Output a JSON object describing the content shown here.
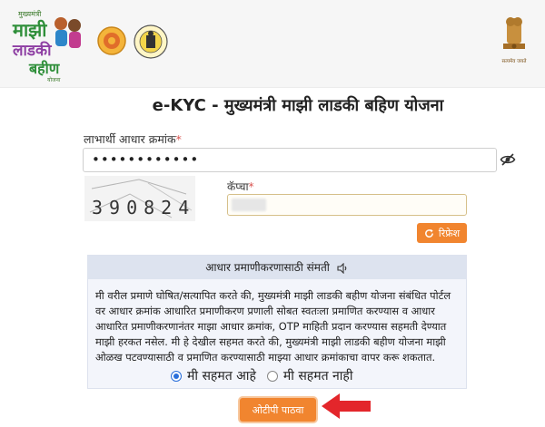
{
  "header": {
    "logo_text_top": "मुख्यमंत्री",
    "logo_text_main": "माझी लाडकी बहीण",
    "logo_text_sub": "योजना",
    "emblem_caption": "सत्यमेव जयते"
  },
  "title": "e-KYC - मुख्यमंत्री माझी लाडकी बहिण योजना",
  "aadhaar": {
    "label": "लाभार्थी आधार क्रमांक",
    "required_mark": "*",
    "value": "••••••••••••"
  },
  "captcha": {
    "code": "390824",
    "label": "कॅप्चा",
    "required_mark": "*"
  },
  "refresh_button": "रिफ्रेश",
  "consent": {
    "heading": "आधार प्रमाणीकरणासाठी संमती",
    "text": "मी वरील प्रमाणे घोषित/सत्यापित करते की, मुख्यमंत्री माझी लाडकी बहीण योजना संबंधित पोर्टल वर आधार क्रमांक आधारित प्रमाणीकरण प्रणाली सोबत स्वतःला प्रमाणित करण्यास व आधार आधारित प्रमाणीकरणानंतर माझा आधार क्रमांक, OTP माहिती प्रदान करण्यास सहमती देण्यात माझी हरकत नसेल. मी हे देखील सहमत करते की, मुख्यमंत्री माझी लाडकी बहीण योजना माझी ओळख पटवण्यासाठी व प्रमाणित करण्यासाठी माझ्या आधार क्रमांकाचा वापर करू शकतात."
  },
  "radios": {
    "agree": "मी सहमत आहे",
    "disagree": "मी सहमत नाही",
    "selected": "agree"
  },
  "otp_button": "ओटीपी पाठवा",
  "colors": {
    "accent": "#f1852f",
    "required": "#d9534f",
    "arrow": "#e3262b",
    "radio_selected": "#2a6fdb"
  },
  "icons": {
    "eye": "eye-slash-icon",
    "refresh": "refresh-icon",
    "speaker": "speaker-icon"
  }
}
